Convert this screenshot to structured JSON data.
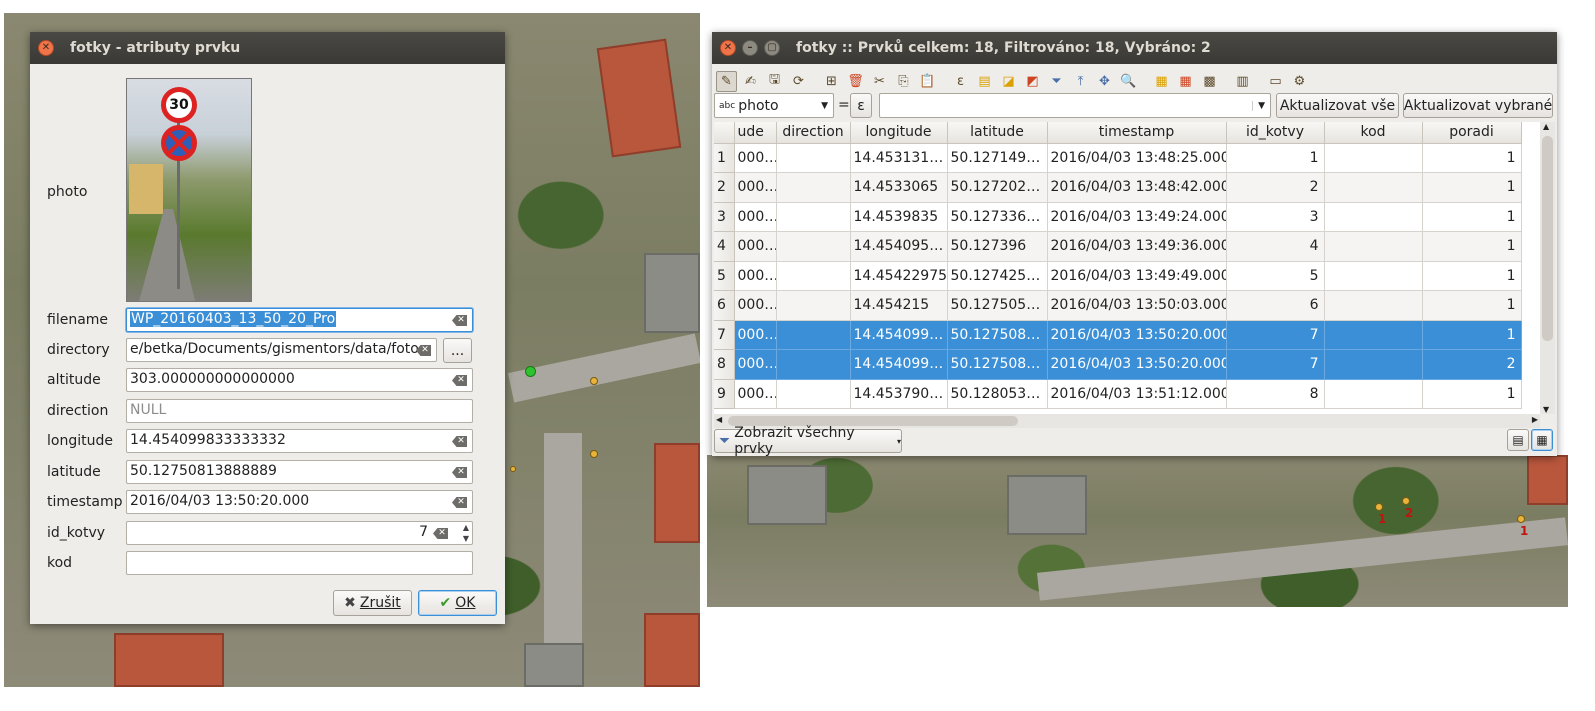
{
  "dialog": {
    "title": "fotky - atributy prvku",
    "fields": [
      {
        "label": "photo"
      },
      {
        "label": "filename",
        "value": "WP_20160403_13_50_20_Pro"
      },
      {
        "label": "directory",
        "value": "e/betka/Documents/gismentors/data/foto",
        "browse_label": "..."
      },
      {
        "label": "altitude",
        "value": "303.000000000000000"
      },
      {
        "label": "direction",
        "placeholder": "NULL"
      },
      {
        "label": "longitude",
        "value": "14.454099833333332"
      },
      {
        "label": "latitude",
        "value": "50.12750813888889"
      },
      {
        "label": "timestamp",
        "value": "2016/04/03 13:50:20.000"
      },
      {
        "label": "id_kotvy",
        "value": "7"
      },
      {
        "label": "kod",
        "value": ""
      }
    ],
    "photo_sign_text": "30",
    "cancel_label": "Zrušit",
    "ok_label": "OK"
  },
  "table_window": {
    "title": "fotky :: Prvků celkem: 18, Filtrováno: 18, Vybráno: 2",
    "field_combo": {
      "type_badge": "abc",
      "value": "photo"
    },
    "equals": "=",
    "expression_icon": "ε",
    "update_all_label": "Aktualizovat vše",
    "update_selected_label": "Aktualizovat vybrané",
    "columns": [
      "ude",
      "direction",
      "longitude",
      "latitude",
      "timestamp",
      "id_kotvy",
      "kod",
      "poradi"
    ],
    "rows": [
      {
        "n": "1",
        "ude": "000…",
        "direction": "",
        "longitude": "14.453131…",
        "latitude": "50.127149…",
        "timestamp": "2016/04/03 13:48:25.000",
        "id_kotvy": "1",
        "kod": "",
        "poradi": "1",
        "selected": false
      },
      {
        "n": "2",
        "ude": "000…",
        "direction": "",
        "longitude": "14.4533065",
        "latitude": "50.127202…",
        "timestamp": "2016/04/03 13:48:42.000",
        "id_kotvy": "2",
        "kod": "",
        "poradi": "1",
        "selected": false
      },
      {
        "n": "3",
        "ude": "000…",
        "direction": "",
        "longitude": "14.4539835",
        "latitude": "50.127336…",
        "timestamp": "2016/04/03 13:49:24.000",
        "id_kotvy": "3",
        "kod": "",
        "poradi": "1",
        "selected": false
      },
      {
        "n": "4",
        "ude": "000…",
        "direction": "",
        "longitude": "14.454095…",
        "latitude": "50.127396",
        "timestamp": "2016/04/03 13:49:36.000",
        "id_kotvy": "4",
        "kod": "",
        "poradi": "1",
        "selected": false
      },
      {
        "n": "5",
        "ude": "000…",
        "direction": "",
        "longitude": "14.45422975",
        "latitude": "50.127425…",
        "timestamp": "2016/04/03 13:49:49.000",
        "id_kotvy": "5",
        "kod": "",
        "poradi": "1",
        "selected": false
      },
      {
        "n": "6",
        "ude": "000…",
        "direction": "",
        "longitude": "14.454215",
        "latitude": "50.127505…",
        "timestamp": "2016/04/03 13:50:03.000",
        "id_kotvy": "6",
        "kod": "",
        "poradi": "1",
        "selected": false
      },
      {
        "n": "7",
        "ude": "000…",
        "direction": "",
        "longitude": "14.454099…",
        "latitude": "50.127508…",
        "timestamp": "2016/04/03 13:50:20.000",
        "id_kotvy": "7",
        "kod": "",
        "poradi": "1",
        "selected": true
      },
      {
        "n": "8",
        "ude": "000…",
        "direction": "",
        "longitude": "14.454099…",
        "latitude": "50.127508…",
        "timestamp": "2016/04/03 13:50:20.000",
        "id_kotvy": "7",
        "kod": "",
        "poradi": "2",
        "selected": true
      },
      {
        "n": "9",
        "ude": "000…",
        "direction": "",
        "longitude": "14.453790…",
        "latitude": "50.128053…",
        "timestamp": "2016/04/03 13:51:12.000",
        "id_kotvy": "8",
        "kod": "",
        "poradi": "1",
        "selected": false
      }
    ],
    "filter_button_label": "Zobrazit všechny prvky"
  },
  "map_labels": [
    "1",
    "2",
    "1"
  ],
  "colors": {
    "selection": "#3b8fd6",
    "titlebar": "#3c3b37",
    "close_button": "#f0744a"
  }
}
